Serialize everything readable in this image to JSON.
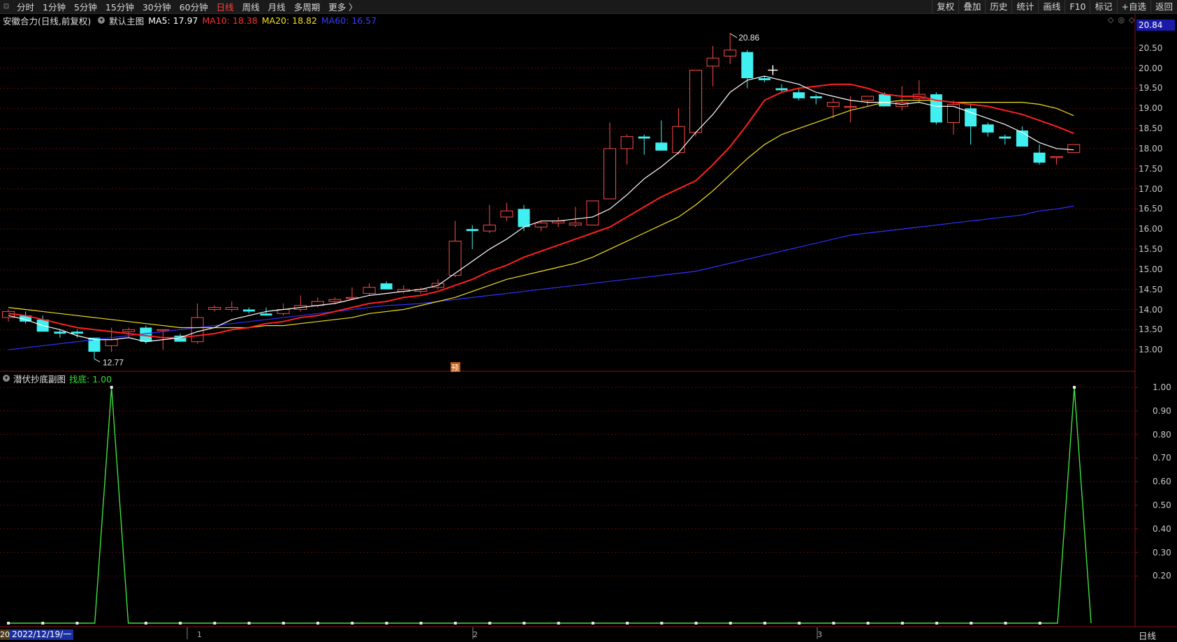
{
  "toolbar": {
    "periods": [
      "分时",
      "1分钟",
      "5分钟",
      "15分钟",
      "30分钟",
      "60分钟",
      "日线",
      "周线",
      "月线",
      "多周期",
      "更多 〉"
    ],
    "active_period": "日线",
    "right_buttons": [
      "复权",
      "叠加",
      "历史",
      "统计",
      "画线",
      "F10",
      "标记",
      "+自选",
      "返回"
    ]
  },
  "main": {
    "stock_title": "安徽合力(日线,前复权)",
    "template": "默认主图",
    "ma5": {
      "label": "MA5: 17.97",
      "color": "#ffffff"
    },
    "ma10": {
      "label": "MA10: 18.38",
      "color": "#ff2020"
    },
    "ma20": {
      "label": "MA20: 18.82",
      "color": "#f0e020"
    },
    "ma60": {
      "label": "MA60: 16.57",
      "color": "#3030ff"
    },
    "price_tag": "20.84",
    "high_label": "20.86",
    "low_label": "12.77",
    "marker": "预",
    "yticks": [
      "20.50",
      "20.00",
      "19.50",
      "19.00",
      "18.50",
      "18.00",
      "17.50",
      "17.00",
      "16.50",
      "16.00",
      "15.50",
      "15.00",
      "14.50",
      "14.00",
      "13.50",
      "13.00"
    ]
  },
  "sub": {
    "title": "潜伏抄底副图",
    "indicator": "找底: 1.00",
    "yticks": [
      "1.00",
      "0.90",
      "0.80",
      "0.70",
      "0.60",
      "0.50",
      "0.40",
      "0.30",
      "0.20"
    ]
  },
  "footer": {
    "date": "2022/12/19/一",
    "date_prefix": "20",
    "month_marks": [
      "1",
      "2",
      "3"
    ],
    "period_label": "日线"
  },
  "chart_data": {
    "type": "candlestick",
    "ylim": [
      12.5,
      21.0
    ],
    "candles": [
      {
        "o": 13.8,
        "h": 14.0,
        "l": 13.7,
        "c": 13.95
      },
      {
        "o": 13.85,
        "h": 13.95,
        "l": 13.65,
        "c": 13.7
      },
      {
        "o": 13.75,
        "h": 13.85,
        "l": 13.45,
        "c": 13.45
      },
      {
        "o": 13.45,
        "h": 13.5,
        "l": 13.3,
        "c": 13.4
      },
      {
        "o": 13.45,
        "h": 13.5,
        "l": 13.3,
        "c": 13.4
      },
      {
        "o": 13.3,
        "h": 13.3,
        "l": 12.77,
        "c": 12.95
      },
      {
        "o": 13.1,
        "h": 13.55,
        "l": 12.95,
        "c": 13.25
      },
      {
        "o": 13.45,
        "h": 13.55,
        "l": 13.3,
        "c": 13.5
      },
      {
        "o": 13.55,
        "h": 13.6,
        "l": 13.15,
        "c": 13.2
      },
      {
        "o": 13.5,
        "h": 13.5,
        "l": 13.0,
        "c": 13.5
      },
      {
        "o": 13.35,
        "h": 13.4,
        "l": 13.2,
        "c": 13.2
      },
      {
        "o": 13.2,
        "h": 14.15,
        "l": 13.15,
        "c": 13.8
      },
      {
        "o": 14.0,
        "h": 14.1,
        "l": 13.95,
        "c": 14.05
      },
      {
        "o": 14.0,
        "h": 14.2,
        "l": 13.95,
        "c": 14.05
      },
      {
        "o": 14.0,
        "h": 14.05,
        "l": 13.9,
        "c": 13.95
      },
      {
        "o": 13.9,
        "h": 14.05,
        "l": 13.85,
        "c": 13.85
      },
      {
        "o": 13.9,
        "h": 14.15,
        "l": 13.85,
        "c": 14.0
      },
      {
        "o": 14.0,
        "h": 14.35,
        "l": 13.95,
        "c": 14.1
      },
      {
        "o": 14.1,
        "h": 14.3,
        "l": 14.05,
        "c": 14.2
      },
      {
        "o": 14.2,
        "h": 14.3,
        "l": 14.15,
        "c": 14.25
      },
      {
        "o": 14.3,
        "h": 14.55,
        "l": 14.3,
        "c": 14.3
      },
      {
        "o": 14.4,
        "h": 14.65,
        "l": 14.35,
        "c": 14.55
      },
      {
        "o": 14.65,
        "h": 14.7,
        "l": 14.5,
        "c": 14.5
      },
      {
        "o": 14.45,
        "h": 14.6,
        "l": 14.4,
        "c": 14.5
      },
      {
        "o": 14.45,
        "h": 14.55,
        "l": 14.4,
        "c": 14.5
      },
      {
        "o": 14.55,
        "h": 14.75,
        "l": 14.5,
        "c": 14.65
      },
      {
        "o": 14.85,
        "h": 16.2,
        "l": 14.8,
        "c": 15.7
      },
      {
        "o": 16.0,
        "h": 16.1,
        "l": 15.5,
        "c": 15.95
      },
      {
        "o": 15.95,
        "h": 16.6,
        "l": 15.9,
        "c": 16.1
      },
      {
        "o": 16.3,
        "h": 16.65,
        "l": 16.2,
        "c": 16.45
      },
      {
        "o": 16.5,
        "h": 16.6,
        "l": 15.95,
        "c": 16.05
      },
      {
        "o": 16.05,
        "h": 16.2,
        "l": 15.95,
        "c": 16.15
      },
      {
        "o": 16.15,
        "h": 16.3,
        "l": 16.05,
        "c": 16.2
      },
      {
        "o": 16.1,
        "h": 16.55,
        "l": 16.05,
        "c": 16.15
      },
      {
        "o": 16.1,
        "h": 16.6,
        "l": 16.1,
        "c": 16.7
      },
      {
        "o": 16.75,
        "h": 18.65,
        "l": 16.75,
        "c": 18.0
      },
      {
        "o": 18.0,
        "h": 18.35,
        "l": 17.6,
        "c": 18.3
      },
      {
        "o": 18.3,
        "h": 18.35,
        "l": 17.85,
        "c": 18.25
      },
      {
        "o": 18.15,
        "h": 18.7,
        "l": 17.95,
        "c": 17.95
      },
      {
        "o": 17.9,
        "h": 19.0,
        "l": 17.85,
        "c": 18.55
      },
      {
        "o": 18.4,
        "h": 19.5,
        "l": 18.3,
        "c": 19.95
      },
      {
        "o": 20.05,
        "h": 20.55,
        "l": 19.55,
        "c": 20.25
      },
      {
        "o": 20.3,
        "h": 20.86,
        "l": 20.1,
        "c": 20.45
      },
      {
        "o": 20.4,
        "h": 20.45,
        "l": 19.5,
        "c": 19.75
      },
      {
        "o": 19.75,
        "h": 19.8,
        "l": 19.65,
        "c": 19.7
      },
      {
        "o": 19.5,
        "h": 19.6,
        "l": 19.4,
        "c": 19.45
      },
      {
        "o": 19.4,
        "h": 19.5,
        "l": 19.2,
        "c": 19.25
      },
      {
        "o": 19.3,
        "h": 19.35,
        "l": 19.1,
        "c": 19.25
      },
      {
        "o": 19.05,
        "h": 19.25,
        "l": 18.75,
        "c": 19.15
      },
      {
        "o": 19.05,
        "h": 19.3,
        "l": 18.65,
        "c": 19.05
      },
      {
        "o": 19.2,
        "h": 19.3,
        "l": 19.05,
        "c": 19.3
      },
      {
        "o": 19.35,
        "h": 19.4,
        "l": 19.05,
        "c": 19.05
      },
      {
        "o": 19.05,
        "h": 19.55,
        "l": 18.95,
        "c": 19.15
      },
      {
        "o": 19.25,
        "h": 19.7,
        "l": 19.15,
        "c": 19.35
      },
      {
        "o": 19.35,
        "h": 19.4,
        "l": 18.6,
        "c": 18.65
      },
      {
        "o": 18.65,
        "h": 19.2,
        "l": 18.35,
        "c": 19.1
      },
      {
        "o": 19.0,
        "h": 19.1,
        "l": 18.1,
        "c": 18.55
      },
      {
        "o": 18.6,
        "h": 18.65,
        "l": 18.3,
        "c": 18.4
      },
      {
        "o": 18.3,
        "h": 18.35,
        "l": 18.1,
        "c": 18.25
      },
      {
        "o": 18.45,
        "h": 18.55,
        "l": 18.05,
        "c": 18.05
      },
      {
        "o": 17.9,
        "h": 18.1,
        "l": 17.6,
        "c": 17.65
      },
      {
        "o": 17.8,
        "h": 17.8,
        "l": 17.6,
        "c": 17.8
      },
      {
        "o": 17.9,
        "h": 18.05,
        "l": 17.9,
        "c": 18.1
      }
    ],
    "ma5": [
      13.85,
      13.75,
      13.6,
      13.5,
      13.35,
      13.25,
      13.25,
      13.3,
      13.2,
      13.25,
      13.3,
      13.45,
      13.55,
      13.75,
      13.85,
      13.95,
      14.0,
      14.05,
      14.1,
      14.15,
      14.25,
      14.35,
      14.4,
      14.45,
      14.5,
      14.6,
      14.9,
      15.2,
      15.5,
      15.75,
      16.05,
      16.2,
      16.2,
      16.25,
      16.3,
      16.5,
      16.85,
      17.25,
      17.55,
      17.9,
      18.4,
      18.85,
      19.4,
      19.7,
      19.8,
      19.7,
      19.6,
      19.4,
      19.3,
      19.2,
      19.15,
      19.15,
      19.1,
      19.15,
      19.05,
      19.05,
      18.9,
      18.75,
      18.6,
      18.4,
      18.15,
      18.0,
      17.97
    ],
    "ma10": [
      13.9,
      13.85,
      13.75,
      13.65,
      13.55,
      13.5,
      13.45,
      13.4,
      13.35,
      13.3,
      13.3,
      13.35,
      13.4,
      13.5,
      13.55,
      13.65,
      13.7,
      13.8,
      13.85,
      13.95,
      14.05,
      14.15,
      14.2,
      14.3,
      14.35,
      14.45,
      14.6,
      14.75,
      14.95,
      15.1,
      15.3,
      15.45,
      15.6,
      15.75,
      15.9,
      16.05,
      16.3,
      16.55,
      16.8,
      17.0,
      17.2,
      17.6,
      18.05,
      18.6,
      19.2,
      19.4,
      19.5,
      19.55,
      19.6,
      19.6,
      19.5,
      19.35,
      19.3,
      19.3,
      19.2,
      19.15,
      19.1,
      19.05,
      18.95,
      18.85,
      18.7,
      18.55,
      18.38
    ],
    "ma20": [
      14.05,
      14.0,
      13.95,
      13.9,
      13.85,
      13.8,
      13.75,
      13.7,
      13.65,
      13.6,
      13.55,
      13.55,
      13.55,
      13.55,
      13.55,
      13.6,
      13.6,
      13.65,
      13.7,
      13.75,
      13.8,
      13.9,
      13.95,
      14.0,
      14.1,
      14.2,
      14.3,
      14.45,
      14.6,
      14.75,
      14.85,
      14.95,
      15.05,
      15.15,
      15.3,
      15.5,
      15.7,
      15.9,
      16.1,
      16.3,
      16.6,
      16.95,
      17.35,
      17.75,
      18.1,
      18.35,
      18.5,
      18.65,
      18.8,
      18.95,
      19.05,
      19.15,
      19.2,
      19.2,
      19.2,
      19.15,
      19.15,
      19.15,
      19.15,
      19.15,
      19.1,
      19.0,
      18.82
    ],
    "ma60": [
      13.0,
      13.05,
      13.1,
      13.15,
      13.2,
      13.25,
      13.3,
      13.35,
      13.4,
      13.45,
      13.5,
      13.55,
      13.6,
      13.65,
      13.7,
      13.75,
      13.8,
      13.85,
      13.9,
      13.95,
      14.0,
      14.05,
      14.1,
      14.12,
      14.15,
      14.2,
      14.25,
      14.3,
      14.35,
      14.4,
      14.45,
      14.5,
      14.55,
      14.6,
      14.65,
      14.7,
      14.75,
      14.8,
      14.85,
      14.9,
      14.95,
      15.05,
      15.15,
      15.25,
      15.35,
      15.45,
      15.55,
      15.65,
      15.75,
      15.85,
      15.9,
      15.95,
      16.0,
      16.05,
      16.1,
      16.15,
      16.2,
      16.25,
      16.3,
      16.35,
      16.45,
      16.5,
      16.57
    ],
    "sub_ylim": [
      0,
      1.0
    ],
    "sub_series": [
      0,
      0,
      0,
      1,
      0,
      0,
      0,
      0,
      0,
      0,
      0,
      0,
      0,
      0,
      0,
      0,
      0,
      0,
      0,
      0,
      0,
      0,
      0,
      0,
      0,
      0,
      0,
      0,
      0,
      0,
      0,
      1
    ]
  }
}
